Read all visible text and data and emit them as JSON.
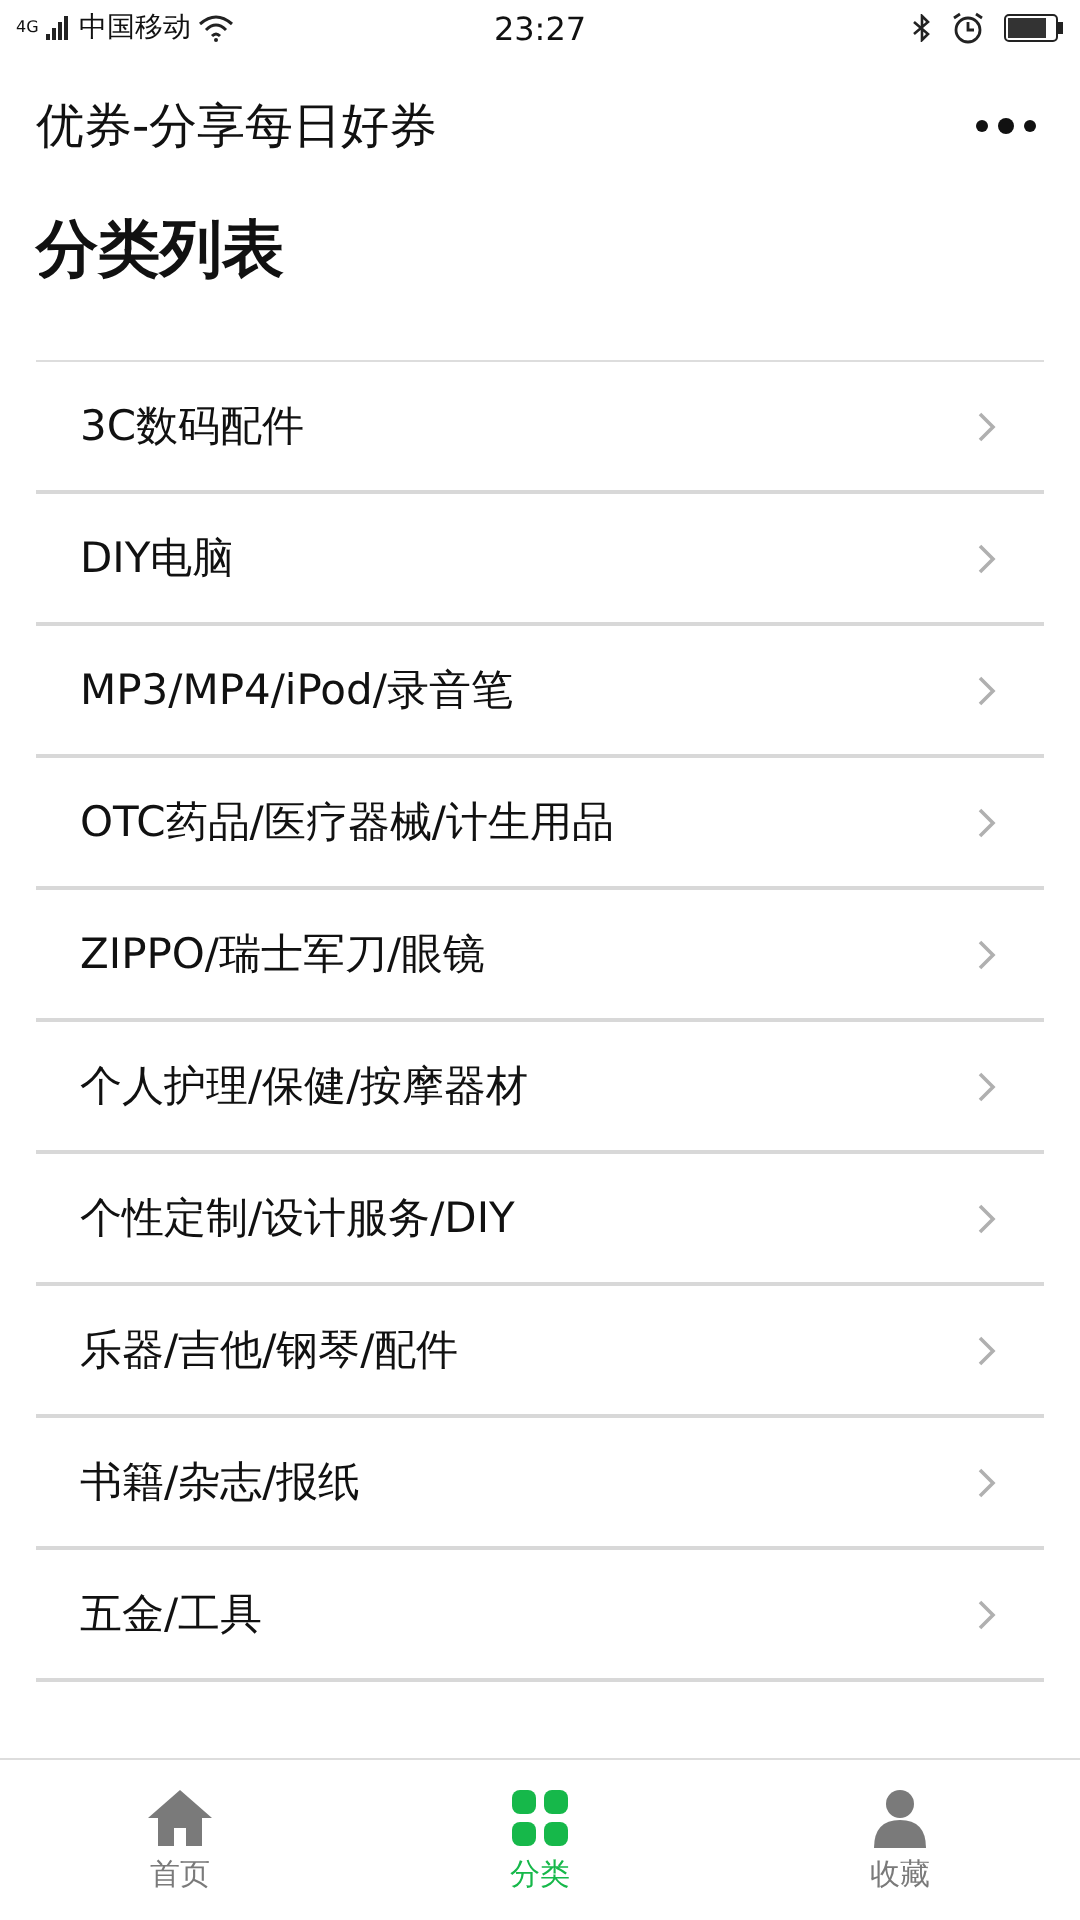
{
  "status_bar": {
    "network": "4G",
    "carrier": "中国移动",
    "time": "23:27"
  },
  "nav_bar": {
    "title": "优券-分享每日好券"
  },
  "heading": "分类列表",
  "categories": [
    {
      "label": "3C数码配件"
    },
    {
      "label": "DIY电脑"
    },
    {
      "label": "MP3/MP4/iPod/录音笔"
    },
    {
      "label": "OTC药品/医疗器械/计生用品"
    },
    {
      "label": "ZIPPO/瑞士军刀/眼镜"
    },
    {
      "label": "个人护理/保健/按摩器材"
    },
    {
      "label": "个性定制/设计服务/DIY"
    },
    {
      "label": "乐器/吉他/钢琴/配件"
    },
    {
      "label": "书籍/杂志/报纸"
    },
    {
      "label": "五金/工具"
    }
  ],
  "tab_bar": [
    {
      "label": "首页",
      "kind": "home",
      "selected": false
    },
    {
      "label": "分类",
      "kind": "grid",
      "selected": true
    },
    {
      "label": "收藏",
      "kind": "person",
      "selected": false
    }
  ]
}
